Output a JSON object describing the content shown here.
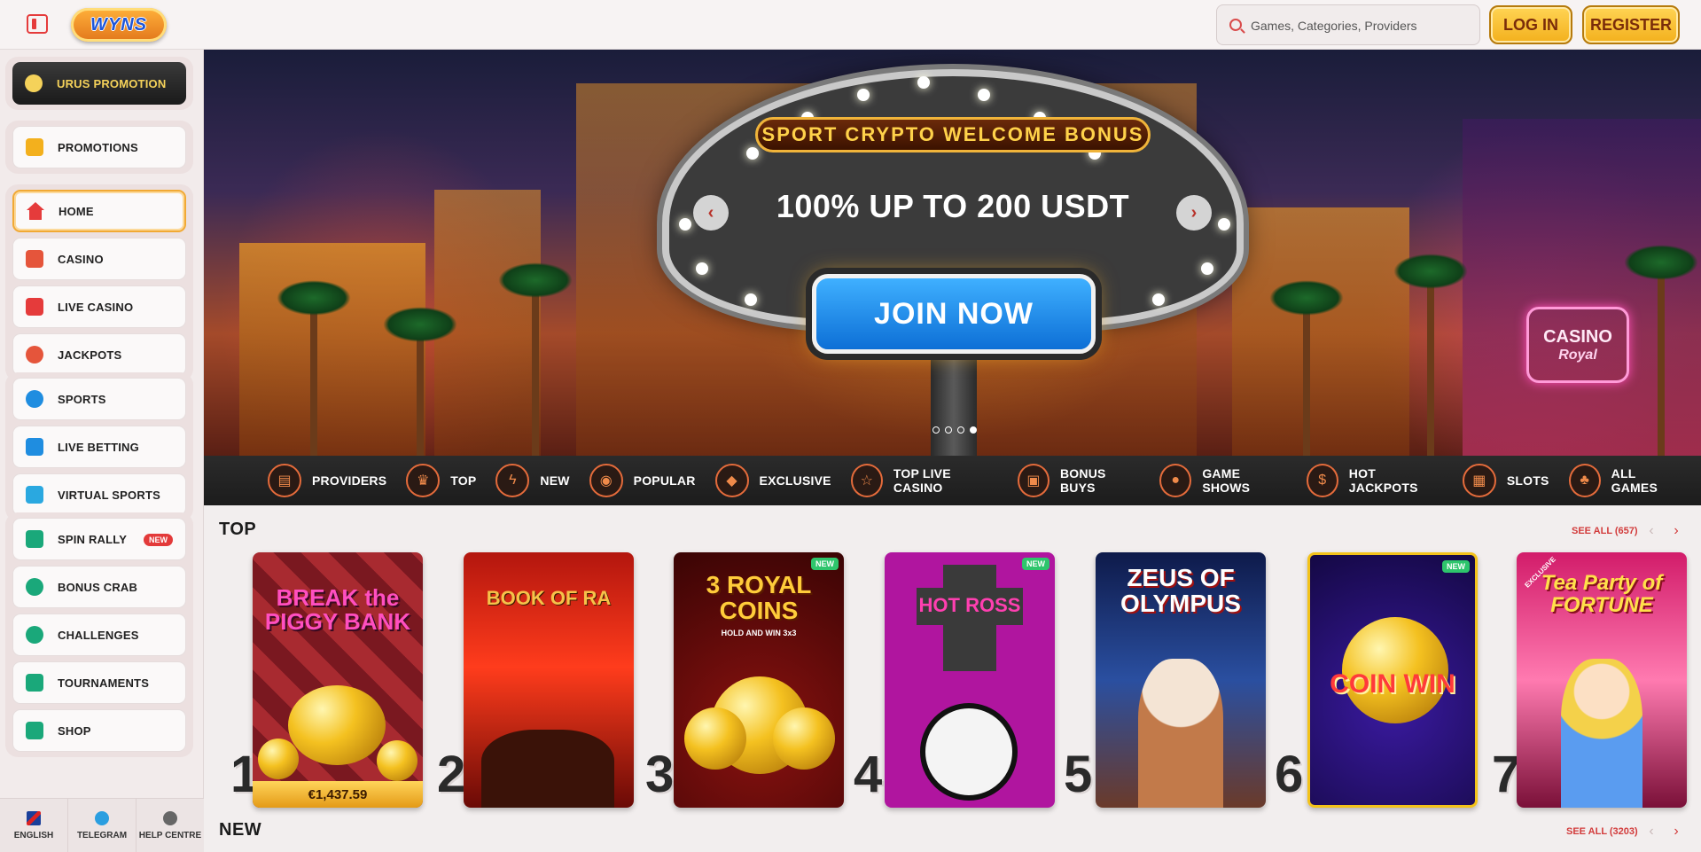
{
  "header": {
    "logo_text": "WYNS",
    "search_placeholder": "Games, Categories, Providers",
    "login_label": "LOG IN",
    "register_label": "REGISTER"
  },
  "sidebar": {
    "promo_group": [
      {
        "label": "URUS PROMOTION"
      }
    ],
    "group_promotions": [
      {
        "label": "PROMOTIONS"
      }
    ],
    "group_main": [
      {
        "label": "HOME"
      },
      {
        "label": "CASINO"
      },
      {
        "label": "LIVE CASINO"
      },
      {
        "label": "JACKPOTS"
      }
    ],
    "group_sports": [
      {
        "label": "SPORTS"
      },
      {
        "label": "LIVE BETTING"
      },
      {
        "label": "VIRTUAL SPORTS"
      }
    ],
    "group_extra": [
      {
        "label": "SPIN RALLY",
        "badge": "NEW"
      },
      {
        "label": "BONUS CRAB"
      },
      {
        "label": "CHALLENGES"
      },
      {
        "label": "TOURNAMENTS"
      },
      {
        "label": "SHOP"
      }
    ],
    "footer": [
      {
        "label": "ENGLISH"
      },
      {
        "label": "TELEGRAM"
      },
      {
        "label": "HELP CENTRE"
      }
    ]
  },
  "banner": {
    "title": "SPORT CRYPTO WELCOME BONUS",
    "subtitle": "100% UP TO 200 USDT",
    "cta": "JOIN NOW",
    "prev_icon": "‹",
    "next_icon": "›",
    "slide_count": 4,
    "active_slide": 4,
    "side_sign": "CASINO",
    "side_sign_sub": "Royal"
  },
  "categories": [
    {
      "label": "PROVIDERS",
      "icon": "providers-icon"
    },
    {
      "label": "TOP",
      "icon": "crown-icon"
    },
    {
      "label": "NEW",
      "icon": "lightning-icon"
    },
    {
      "label": "POPULAR",
      "icon": "fire-icon"
    },
    {
      "label": "EXCLUSIVE",
      "icon": "diamond-icon"
    },
    {
      "label": "TOP LIVE CASINO",
      "icon": "star-icon"
    },
    {
      "label": "BONUS BUYS",
      "icon": "gift-icon"
    },
    {
      "label": "GAME SHOWS",
      "icon": "microphone-icon"
    },
    {
      "label": "HOT JACKPOTS",
      "icon": "moneybag-icon"
    },
    {
      "label": "SLOTS",
      "icon": "slot-icon"
    },
    {
      "label": "ALL GAMES",
      "icon": "cherry-icon"
    }
  ],
  "top_section": {
    "title": "TOP",
    "see_all": "SEE ALL (657)",
    "games": [
      {
        "rank": "1",
        "title": "BREAK the PIGGY BANK",
        "jackpot": "€1,437.59"
      },
      {
        "rank": "2",
        "title": "BOOK OF RA"
      },
      {
        "rank": "3",
        "title": "3 ROYAL COINS",
        "subtitle": "HOLD AND WIN 3x3",
        "badge": "NEW"
      },
      {
        "rank": "4",
        "title": "HOT ROSS",
        "badge": "NEW"
      },
      {
        "rank": "5",
        "title": "ZEUS OF OLYMPUS"
      },
      {
        "rank": "6",
        "title": "COIN WIN",
        "badge": "NEW"
      },
      {
        "rank": "7",
        "title": "Tea Party of FORTUNE",
        "tag": "EXCLUSIVE"
      }
    ]
  },
  "new_section": {
    "title": "NEW",
    "see_all": "SEE ALL (3203)"
  },
  "colors": {
    "accent": "#e53b3b",
    "gold": "#f3b01d",
    "sidebar_bg": "#f2ebeb",
    "category_bar": "#1c1c1c"
  }
}
